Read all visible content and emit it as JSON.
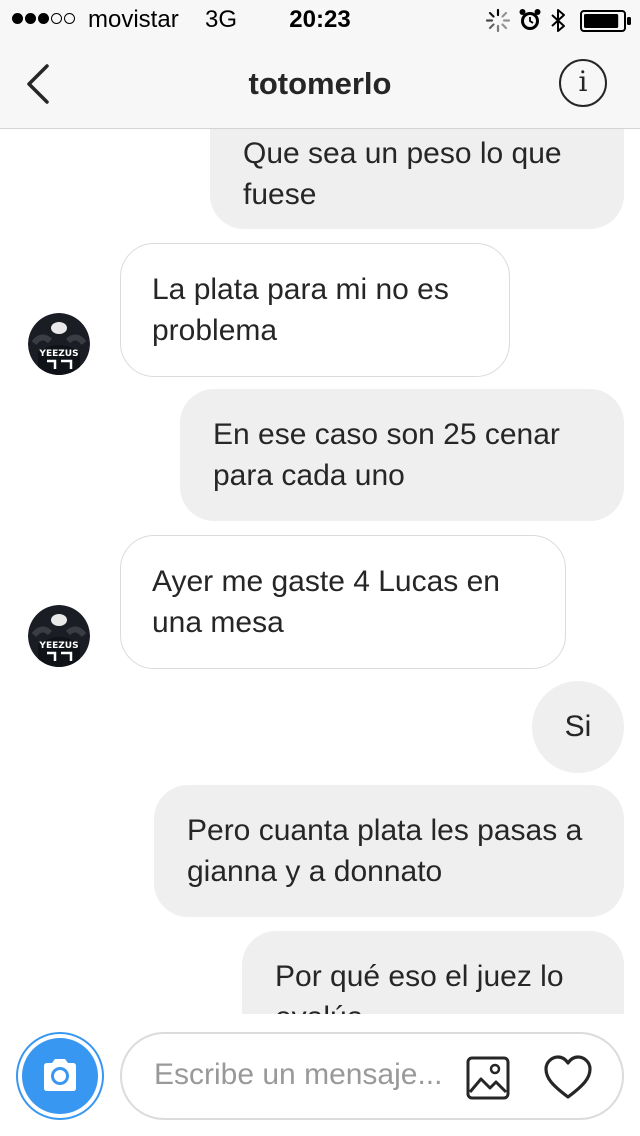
{
  "status_bar": {
    "carrier": "movistar",
    "network": "3G",
    "time": "20:23",
    "signal_icon": "signal-dots-icon",
    "activity_icon": "activity-spinner-icon",
    "alarm_icon": "alarm-clock-icon",
    "bluetooth_icon": "bluetooth-icon",
    "battery_icon": "battery-icon",
    "battery_level": 0.9
  },
  "header": {
    "title": "totomerlo",
    "back_icon": "chevron-left-icon",
    "info_icon": "i"
  },
  "messages": [
    {
      "direction": "outgoing",
      "text": "Que sea un peso lo que fuese"
    },
    {
      "direction": "incoming",
      "text": "La plata para mi no es problema"
    },
    {
      "direction": "outgoing",
      "text": "En ese caso son 25 cenar para cada uno"
    },
    {
      "direction": "incoming",
      "text": "Ayer me gaste 4 Lucas en una mesa"
    },
    {
      "direction": "outgoing",
      "text": "Si"
    },
    {
      "direction": "outgoing",
      "text": "Pero cuanta plata les pasas a gianna y a donnato"
    },
    {
      "direction": "outgoing",
      "text": "Por qué eso el juez lo evalúa"
    }
  ],
  "avatar": {
    "shirt_text": "YEEZUS"
  },
  "composer": {
    "placeholder": "Escribe un mensaje...",
    "camera_icon": "camera-icon",
    "gallery_icon": "image-gallery-icon",
    "like_icon": "heart-icon"
  },
  "colors": {
    "accent_blue": "#3897f0",
    "outgoing_bubble": "#efefef",
    "incoming_border": "#dbdbdb",
    "text": "#262626",
    "placeholder": "#999999"
  }
}
